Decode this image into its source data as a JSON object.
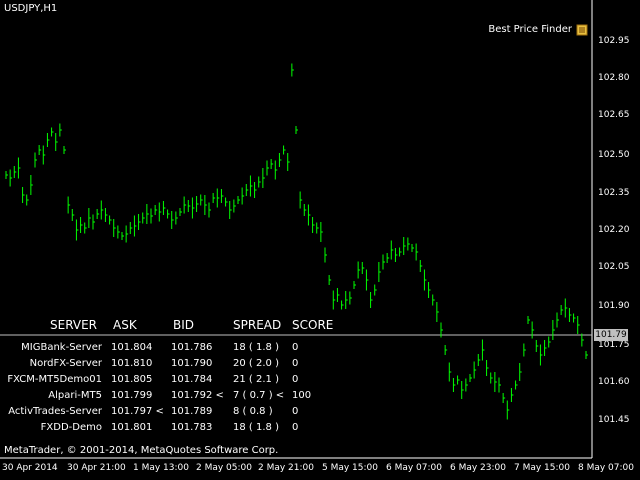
{
  "symbol_label": "USDJPY,H1",
  "indicator_label": "Best Price Finder",
  "copyright": "MetaTrader, © 2001-2014, MetaQuotes Software Corp.",
  "current_price": "101.79",
  "colors": {
    "bars": "#00ff00",
    "background": "#000000",
    "axis": "#ffffff",
    "price_line": "#c0c0c0"
  },
  "y_axis": {
    "ticks": [
      "102.95",
      "102.80",
      "102.65",
      "102.50",
      "102.35",
      "102.20",
      "102.05",
      "101.90",
      "101.75",
      "101.60",
      "101.45"
    ]
  },
  "x_axis": {
    "ticks": [
      "30 Apr 2014",
      "30 Apr 21:00",
      "1 May 13:00",
      "2 May 05:00",
      "2 May 21:00",
      "5 May 15:00",
      "6 May 07:00",
      "6 May 23:00",
      "7 May 15:00",
      "8 May 07:00"
    ]
  },
  "table": {
    "headers": [
      "SERVER",
      "ASK",
      "BID",
      "SPREAD",
      "SCORE"
    ],
    "rows": [
      {
        "server": "MIGBank-Server",
        "ask": "101.804",
        "bid": "101.786",
        "spread": "18 ( 1.8 )",
        "score": "0"
      },
      {
        "server": "NordFX-Server",
        "ask": "101.810",
        "bid": "101.790",
        "spread": "20 ( 2.0 )",
        "score": "0"
      },
      {
        "server": "FXCM-MT5Demo01",
        "ask": "101.805",
        "bid": "101.784",
        "spread": "21 ( 2.1 )",
        "score": "0"
      },
      {
        "server": "Alpari-MT5",
        "ask": "101.799",
        "bid": "101.792 <",
        "spread": "7 ( 0.7 )  <",
        "score": "100"
      },
      {
        "server": "ActivTrades-Server",
        "ask": "101.797 <",
        "bid": "101.789",
        "spread": "8 ( 0.8 )",
        "score": "0"
      },
      {
        "server": "FXDD-Demo",
        "ask": "101.801",
        "bid": "101.783",
        "spread": "18 ( 1.8 )",
        "score": "0"
      }
    ]
  }
}
